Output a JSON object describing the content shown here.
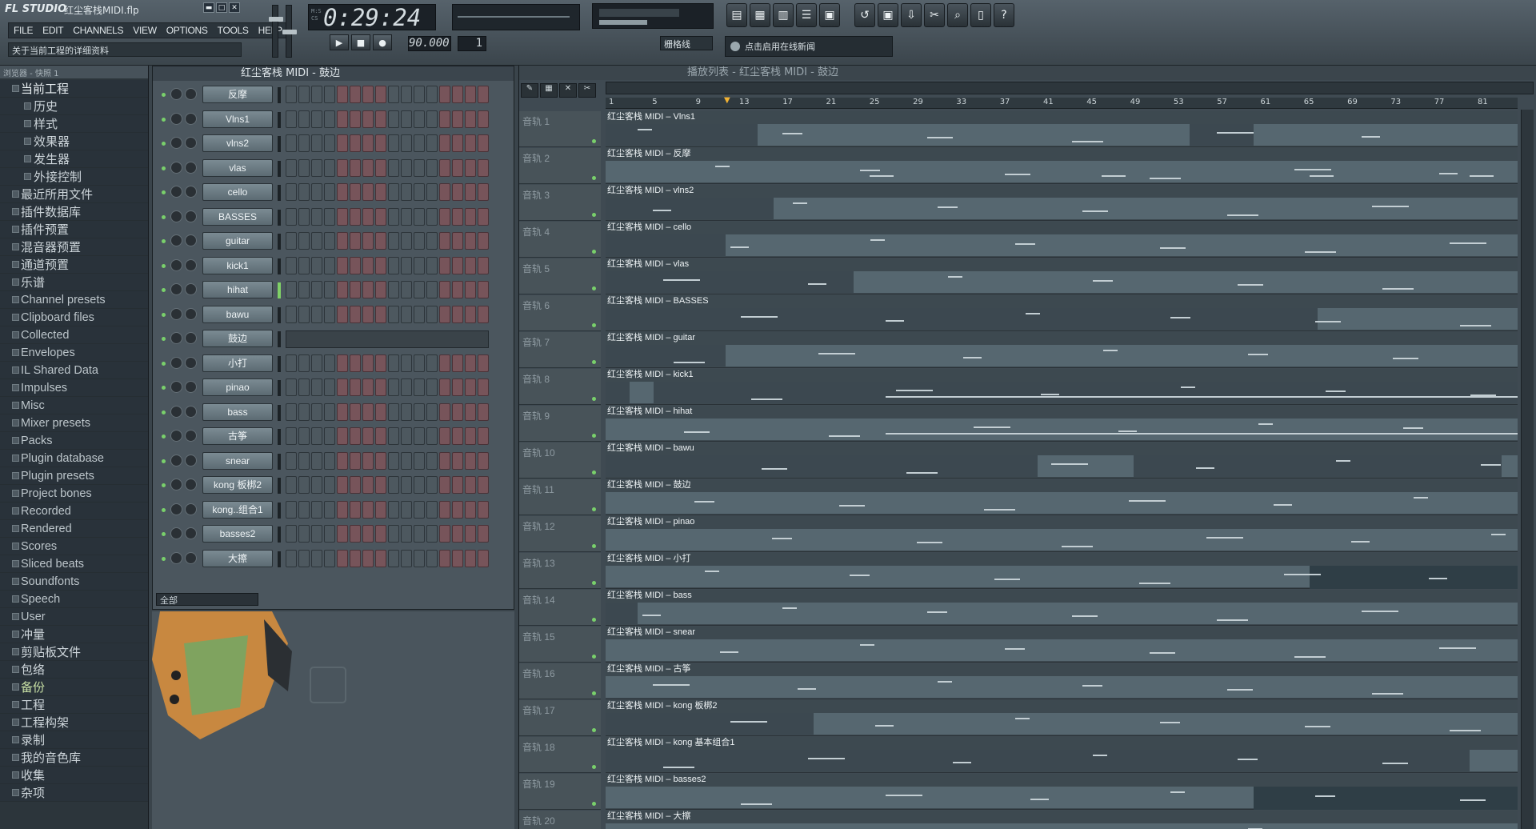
{
  "app": {
    "logo": "FL STUDIO",
    "filename": "红尘客栈MIDI.flp",
    "hint": "关于当前工程的详细资料"
  },
  "menu": [
    "FILE",
    "EDIT",
    "CHANNELS",
    "VIEW",
    "OPTIONS",
    "TOOLS",
    "HELP"
  ],
  "transport": {
    "time": "0:29:24",
    "time_top": "M:S",
    "time_bottom": "CS",
    "tempo": "90.000",
    "pattern": "1",
    "snap": "栅格线",
    "news": "点击启用在线新闻"
  },
  "browser": {
    "header": "浏览器 - 快照 1",
    "items": [
      {
        "label": "当前工程",
        "kind": "hl"
      },
      {
        "label": "历史",
        "kind": "sub"
      },
      {
        "label": "样式",
        "kind": "sub"
      },
      {
        "label": "效果器",
        "kind": "sub"
      },
      {
        "label": "发生器",
        "kind": "sub"
      },
      {
        "label": "外接控制",
        "kind": "sub"
      },
      {
        "label": "最近所用文件",
        "kind": "cn"
      },
      {
        "label": "插件数据库",
        "kind": "cn"
      },
      {
        "label": "插件预置",
        "kind": "cn"
      },
      {
        "label": "混音器预置",
        "kind": "cn"
      },
      {
        "label": "通道预置",
        "kind": "cn"
      },
      {
        "label": "乐谱",
        "kind": "cn"
      },
      {
        "label": "Channel presets",
        "kind": "lat"
      },
      {
        "label": "Clipboard files",
        "kind": "lat"
      },
      {
        "label": "Collected",
        "kind": "lat"
      },
      {
        "label": "Envelopes",
        "kind": "lat"
      },
      {
        "label": "IL Shared Data",
        "kind": "lat"
      },
      {
        "label": "Impulses",
        "kind": "lat"
      },
      {
        "label": "Misc",
        "kind": "lat"
      },
      {
        "label": "Mixer presets",
        "kind": "lat"
      },
      {
        "label": "Packs",
        "kind": "lat"
      },
      {
        "label": "Plugin database",
        "kind": "lat"
      },
      {
        "label": "Plugin presets",
        "kind": "lat"
      },
      {
        "label": "Project bones",
        "kind": "lat"
      },
      {
        "label": "Recorded",
        "kind": "lat"
      },
      {
        "label": "Rendered",
        "kind": "lat"
      },
      {
        "label": "Scores",
        "kind": "lat"
      },
      {
        "label": "Sliced beats",
        "kind": "lat"
      },
      {
        "label": "Soundfonts",
        "kind": "lat"
      },
      {
        "label": "Speech",
        "kind": "lat"
      },
      {
        "label": "User",
        "kind": "lat"
      },
      {
        "label": "冲量",
        "kind": "cn"
      },
      {
        "label": "剪贴板文件",
        "kind": "cn"
      },
      {
        "label": "包络",
        "kind": "cn"
      },
      {
        "label": "备份",
        "kind": "green"
      },
      {
        "label": "工程",
        "kind": "cn"
      },
      {
        "label": "工程构架",
        "kind": "cn"
      },
      {
        "label": "录制",
        "kind": "cn"
      },
      {
        "label": "我的音色库",
        "kind": "cn"
      },
      {
        "label": "收集",
        "kind": "cn"
      },
      {
        "label": "杂项",
        "kind": "cn"
      }
    ]
  },
  "sequencer": {
    "title": "红尘客栈 MIDI - 鼓边",
    "filter": "全部",
    "channels": [
      {
        "name": "反摩",
        "sel": false
      },
      {
        "name": "Vlns1",
        "sel": false
      },
      {
        "name": "vlns2",
        "sel": false
      },
      {
        "name": "vlas",
        "sel": false
      },
      {
        "name": "cello",
        "sel": false
      },
      {
        "name": "BASSES",
        "sel": false
      },
      {
        "name": "guitar",
        "sel": false
      },
      {
        "name": "kick1",
        "sel": false
      },
      {
        "name": "hihat",
        "sel": true
      },
      {
        "name": "bawu",
        "sel": false
      },
      {
        "name": "鼓边",
        "sel": false,
        "ghost": true
      },
      {
        "name": "小打",
        "sel": false
      },
      {
        "name": "pinao",
        "sel": false
      },
      {
        "name": "bass",
        "sel": false
      },
      {
        "name": "古筝",
        "sel": false
      },
      {
        "name": "snear",
        "sel": false
      },
      {
        "name": "kong 板梆2",
        "sel": false
      },
      {
        "name": "kong..组合1",
        "sel": false
      },
      {
        "name": "basses2",
        "sel": false
      },
      {
        "name": "大擦",
        "sel": false
      }
    ]
  },
  "playlist": {
    "title": "播放列表 - 红尘客栈 MIDI - 鼓边",
    "ruler": [
      "1",
      "5",
      "9",
      "13",
      "17",
      "21",
      "25",
      "29",
      "33",
      "37",
      "41",
      "45",
      "49",
      "53",
      "57",
      "61",
      "65",
      "69",
      "73",
      "77",
      "81"
    ],
    "tracks": [
      {
        "label": "音轨 1",
        "clip": "红尘客栈 MIDI – Vlns1"
      },
      {
        "label": "音轨 2",
        "clip": "红尘客栈 MIDI – 反摩"
      },
      {
        "label": "音轨 3",
        "clip": "红尘客栈 MIDI – vlns2"
      },
      {
        "label": "音轨 4",
        "clip": "红尘客栈 MIDI – cello"
      },
      {
        "label": "音轨 5",
        "clip": "红尘客栈 MIDI – vlas"
      },
      {
        "label": "音轨 6",
        "clip": "红尘客栈 MIDI – BASSES"
      },
      {
        "label": "音轨 7",
        "clip": "红尘客栈 MIDI – guitar"
      },
      {
        "label": "音轨 8",
        "clip": "红尘客栈 MIDI – kick1"
      },
      {
        "label": "音轨 9",
        "clip": "红尘客栈 MIDI – hihat"
      },
      {
        "label": "音轨 10",
        "clip": "红尘客栈 MIDI – bawu"
      },
      {
        "label": "音轨 11",
        "clip": "红尘客栈 MIDI – 鼓边"
      },
      {
        "label": "音轨 12",
        "clip": "红尘客栈 MIDI – pinao"
      },
      {
        "label": "音轨 13",
        "clip": "红尘客栈 MIDI – 小打"
      },
      {
        "label": "音轨 14",
        "clip": "红尘客栈 MIDI – bass"
      },
      {
        "label": "音轨 15",
        "clip": "红尘客栈 MIDI – snear"
      },
      {
        "label": "音轨 16",
        "clip": "红尘客栈 MIDI – 古筝"
      },
      {
        "label": "音轨 17",
        "clip": "红尘客栈 MIDI – kong 板梆2"
      },
      {
        "label": "音轨 18",
        "clip": "红尘客栈 MIDI – kong 基本组合1"
      },
      {
        "label": "音轨 19",
        "clip": "红尘客栈 MIDI – basses2"
      },
      {
        "label": "音轨 20",
        "clip": "红尘客栈 MIDI – 大擦"
      }
    ]
  }
}
